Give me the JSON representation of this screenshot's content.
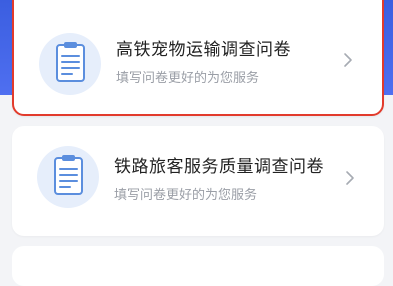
{
  "surveys": [
    {
      "title": "高铁宠物运输调查问卷",
      "subtitle": "填写问卷更好的为您服务",
      "icon": "survey-document-icon"
    },
    {
      "title": "铁路旅客服务质量调查问卷",
      "subtitle": "填写问卷更好的为您服务",
      "icon": "survey-document-icon"
    }
  ],
  "colors": {
    "accent_band": "#4466e8",
    "selected_border": "#e23b2c",
    "icon_bg": "#e6eefb",
    "icon_accent": "#5b8ede"
  }
}
